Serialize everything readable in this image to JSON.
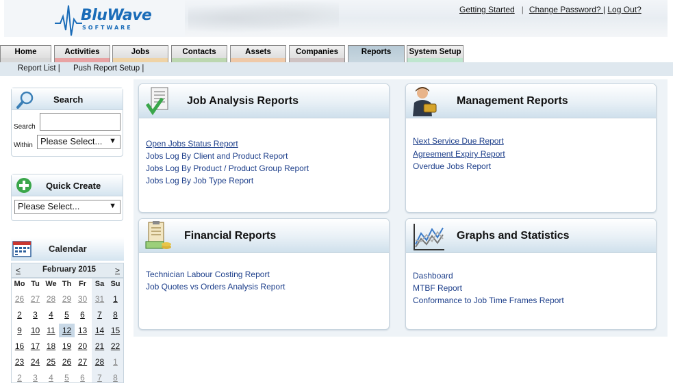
{
  "header": {
    "logo_brand": "BluWave",
    "logo_sub": "SOFTWARE",
    "links": {
      "getting_started": "Getting Started",
      "change_password": "Change Password? |",
      "log_out": "Log Out?"
    }
  },
  "tabs": [
    {
      "label": "Home",
      "band": "#d7d7d7"
    },
    {
      "label": "Activities",
      "band": "#e8a3a3"
    },
    {
      "label": "Jobs",
      "band": "#efd3a6"
    },
    {
      "label": "Contacts",
      "band": "#bcd7b0"
    },
    {
      "label": "Assets",
      "band": "#efc9a8"
    },
    {
      "label": "Companies",
      "band": "#cfc3c3"
    },
    {
      "label": "Reports",
      "band": "#b7cad6"
    },
    {
      "label": "System Setup",
      "band": "#bfe6cf"
    }
  ],
  "active_tab": "Reports",
  "subnav": {
    "item1": "Report List |",
    "item2": "Push Report Setup |"
  },
  "search": {
    "title": "Search",
    "search_label": "Search",
    "within_label": "Within",
    "search_value": "",
    "within_value": "Please Select..."
  },
  "quick_create": {
    "title": "Quick Create",
    "value": "Please Select..."
  },
  "calendar": {
    "title": "Calendar",
    "prev": "<",
    "next": ">",
    "month": "February 2015",
    "dow": [
      "Mo",
      "Tu",
      "We",
      "Th",
      "Fr",
      "Sa",
      "Su"
    ],
    "weeks": [
      [
        "26",
        "27",
        "28",
        "29",
        "30",
        "31",
        "1"
      ],
      [
        "2",
        "3",
        "4",
        "5",
        "6",
        "7",
        "8"
      ],
      [
        "9",
        "10",
        "11",
        "12",
        "13",
        "14",
        "15"
      ],
      [
        "16",
        "17",
        "18",
        "19",
        "20",
        "21",
        "22"
      ],
      [
        "23",
        "24",
        "25",
        "26",
        "27",
        "28",
        "1"
      ],
      [
        "2",
        "3",
        "4",
        "5",
        "6",
        "7",
        "8"
      ]
    ],
    "today": "12"
  },
  "panels": {
    "job_analysis": {
      "title": "Job Analysis Reports",
      "links": [
        "Open Jobs Status Report",
        "Jobs Log By Client and Product Report",
        "Jobs Log By Product / Product Group Report",
        "Jobs Log By Job Type Report"
      ]
    },
    "management": {
      "title": "Management Reports",
      "links": [
        "Next Service Due Report",
        "Agreement Expiry Report",
        "Overdue Jobs Report"
      ]
    },
    "financial": {
      "title": "Financial Reports",
      "links": [
        "Technician Labour Costing Report",
        "Job Quotes vs Orders Analysis Report"
      ]
    },
    "graphs": {
      "title": "Graphs and Statistics",
      "links": [
        "Dashboard",
        "MTBF Report",
        "Conformance to Job Time Frames Report"
      ]
    }
  }
}
